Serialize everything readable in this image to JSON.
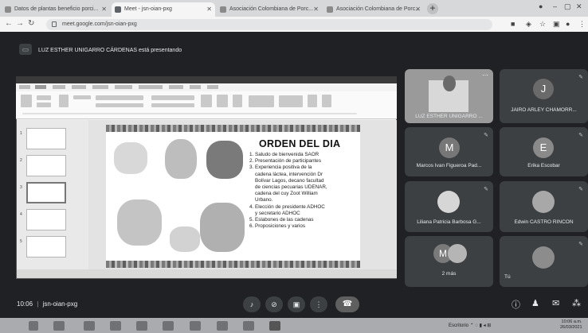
{
  "browser": {
    "tabs": [
      {
        "label": "Datos de plantas beneficio porci...",
        "active": false
      },
      {
        "label": "Meet - jsn-oian-pxg",
        "active": true
      },
      {
        "label": "Asociación Colombiana de Porc...",
        "active": false
      },
      {
        "label": "Asociación Colombiana de Porc...",
        "active": false
      }
    ],
    "url": "meet.google.com/jsn-oian-pxg"
  },
  "meet": {
    "presenting_banner": "LUZ ESTHER UNIGARRO CÁRDENAS está presentando",
    "time": "10:06",
    "separator": "|",
    "meeting_code": "jsn-oian-pxg"
  },
  "slide": {
    "title": "ORDEN DEL DIA",
    "agenda": [
      "1. Saludo de bienvenida SAOR",
      "2. Presentación de participantes",
      "3. Experiencia positiva de la",
      "    cadena láctea, intervención Dr",
      "    Bolívar Lagos, decano facultad",
      "    de ciencias pecuarias UDENAR,",
      "    cadena del cuy Zoot William",
      "    Urbano.",
      "4. Elección de presidente ADHOC",
      "    y secretario ADHOC",
      "5. Eslabones de las cadenas",
      "6. Proposiciones y varios"
    ]
  },
  "participants": [
    {
      "name": "LUZ ESTHER UNIGARRO ...",
      "initial": "",
      "type": "video"
    },
    {
      "name": "JAIRO ARLEY CHAMORR...",
      "initial": "J",
      "color": "#6a6a6a"
    },
    {
      "name": "Marcos Ivan Figueroa Pad...",
      "initial": "M",
      "color": "#777777"
    },
    {
      "name": "Erika Escobar",
      "initial": "E",
      "color": "#8a8a8a"
    },
    {
      "name": "Liliana Patricia Barbosa G...",
      "initial": "",
      "type": "photo"
    },
    {
      "name": "Edwin CASTRO RINCON",
      "initial": "",
      "type": "photo"
    },
    {
      "name": "2 más",
      "initial": "M",
      "color": "#7a7a7a"
    },
    {
      "name": "Tú",
      "initial": "",
      "type": "photo"
    }
  ],
  "taskbar": {
    "tray_text": "Escritorio",
    "clock_time": "10:06 a.m.",
    "clock_date": "26/03/2021"
  }
}
